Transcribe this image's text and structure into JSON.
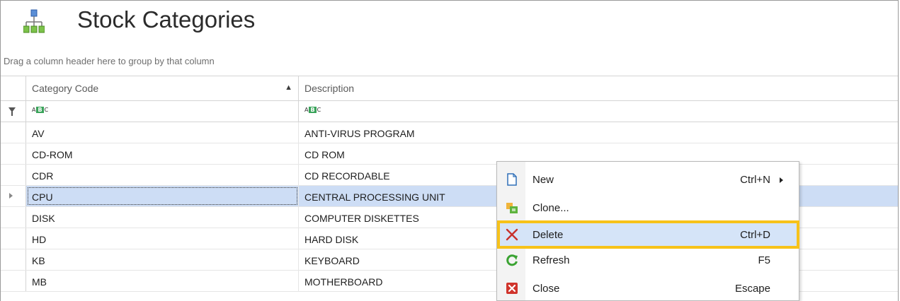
{
  "window": {
    "title": "Stock Categories",
    "title_icon": "hierarchy-icon",
    "group_panel_text": "Drag a column header here to group by that column"
  },
  "grid": {
    "columns": [
      {
        "label": "Category Code",
        "sort": "ascending"
      },
      {
        "label": "Description"
      }
    ],
    "filter_row": {
      "filter_icon": "filter-icon",
      "cell_icon": "abc-text-filter-icon",
      "abc_prefix": "A",
      "abc_mid": "B",
      "abc_suffix": "C"
    },
    "rows": [
      {
        "code": "AV",
        "description": "ANTI-VIRUS PROGRAM"
      },
      {
        "code": "CD-ROM",
        "description": "CD ROM"
      },
      {
        "code": "CDR",
        "description": "CD RECORDABLE"
      },
      {
        "code": "CPU",
        "description": "CENTRAL PROCESSING UNIT",
        "focused": true
      },
      {
        "code": "DISK",
        "description": "COMPUTER DISKETTES"
      },
      {
        "code": "HD",
        "description": "HARD DISK"
      },
      {
        "code": "KB",
        "description": "KEYBOARD"
      },
      {
        "code": "MB",
        "description": "MOTHERBOARD"
      }
    ]
  },
  "context_menu": {
    "items": [
      {
        "label": "New",
        "shortcut": "Ctrl+N",
        "icon": "new-document-icon",
        "has_submenu": true
      },
      {
        "label": "Clone...",
        "shortcut": "",
        "icon": "clone-icon"
      },
      {
        "label": "Delete",
        "shortcut": "Ctrl+D",
        "icon": "delete-x-icon",
        "highlighted": true
      },
      {
        "label": "Refresh",
        "shortcut": "F5",
        "icon": "refresh-icon"
      },
      {
        "label": "Close",
        "shortcut": "Escape",
        "icon": "close-icon"
      }
    ]
  },
  "colors": {
    "selected_row": "#cdddf5",
    "menu_highlight": "#d5e4f8",
    "callout_border": "#f7c21a"
  }
}
